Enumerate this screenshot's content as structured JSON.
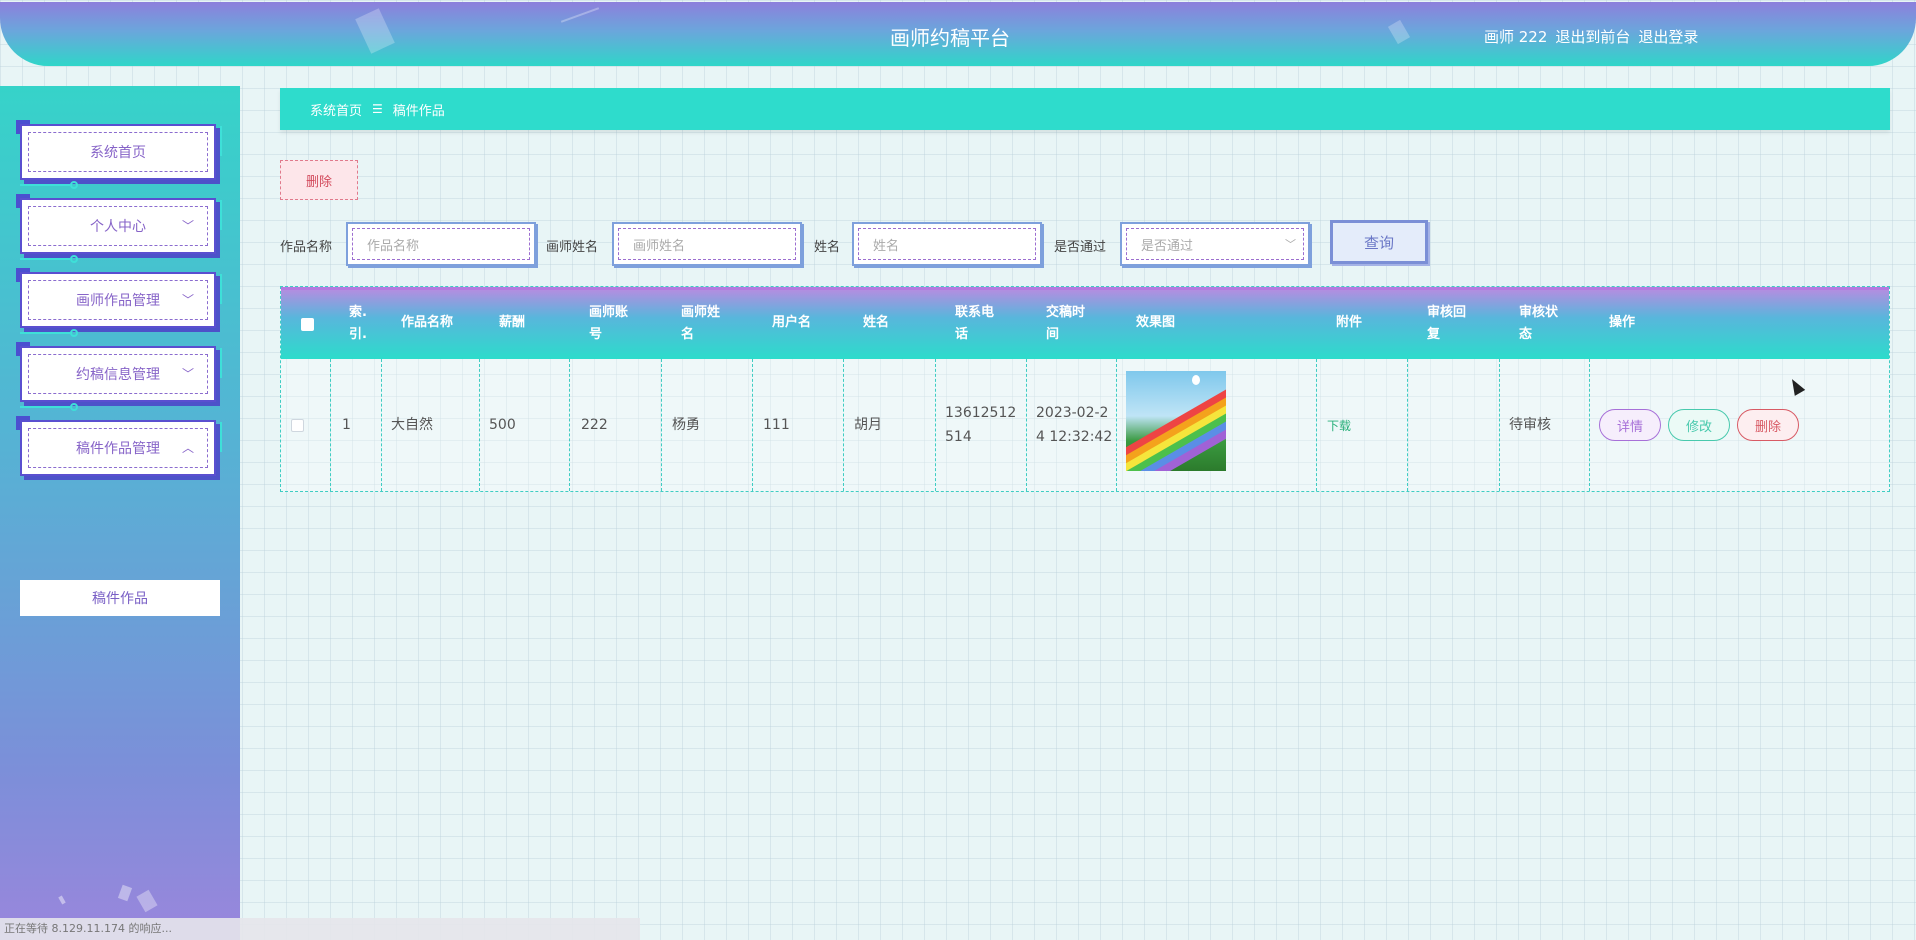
{
  "header": {
    "title": "画师约稿平台",
    "user_label": "画师 222",
    "back_to_front": "退出到前台",
    "logout": "退出登录"
  },
  "sidebar": {
    "items": [
      {
        "label": "系统首页"
      },
      {
        "label": "个人中心",
        "chevron": "chevron-down-icon"
      },
      {
        "label": "画师作品管理",
        "chevron": "chevron-down-icon"
      },
      {
        "label": "约稿信息管理",
        "chevron": "chevron-down-icon"
      },
      {
        "label": "稿件作品管理",
        "chevron": "chevron-up-icon"
      }
    ],
    "active_sub": "稿件作品"
  },
  "breadcrumb": {
    "home": "系统首页",
    "separator": "☰",
    "current": "稿件作品"
  },
  "actions": {
    "delete_label": "删除"
  },
  "search": {
    "work_name_label": "作品名称",
    "work_name_placeholder": "作品名称",
    "artist_name_label": "画师姓名",
    "artist_name_placeholder": "画师姓名",
    "name_label": "姓名",
    "name_placeholder": "姓名",
    "passed_label": "是否通过",
    "passed_placeholder": "是否通过",
    "query_label": "查询"
  },
  "table": {
    "headers": {
      "index": [
        "索.",
        "引."
      ],
      "work_name": "作品名称",
      "pay": "薪酬",
      "artist_account": [
        "画师账",
        "号"
      ],
      "artist_name": [
        "画师姓",
        "名"
      ],
      "username": "用户名",
      "name": "姓名",
      "phone": [
        "联系电",
        "话"
      ],
      "submit_time": [
        "交稿时",
        "间"
      ],
      "effect_image": "效果图",
      "attachment": "附件",
      "review_reply": [
        "审核回",
        "复"
      ],
      "review_status": [
        "审核状",
        "态"
      ],
      "operation": "操作"
    },
    "rows": [
      {
        "index": "1",
        "work_name": "大自然",
        "pay": "500",
        "artist_account": "222",
        "artist_name": "杨勇",
        "username": "111",
        "name": "胡月",
        "phone": [
          "13612512",
          "514"
        ],
        "submit_time": [
          "2023-02-2",
          "4 12:32:42"
        ],
        "attachment": "下载",
        "review_reply": "",
        "review_status": "待审核",
        "op_detail": "详情",
        "op_edit": "修改",
        "op_delete": "删除"
      }
    ]
  },
  "statusbar": {
    "text": "正在等待 8.129.11.174 的响应..."
  },
  "colors": {
    "accent_teal": "#2edccc",
    "accent_purple": "#8d7fdc",
    "danger": "#d24a5c"
  }
}
